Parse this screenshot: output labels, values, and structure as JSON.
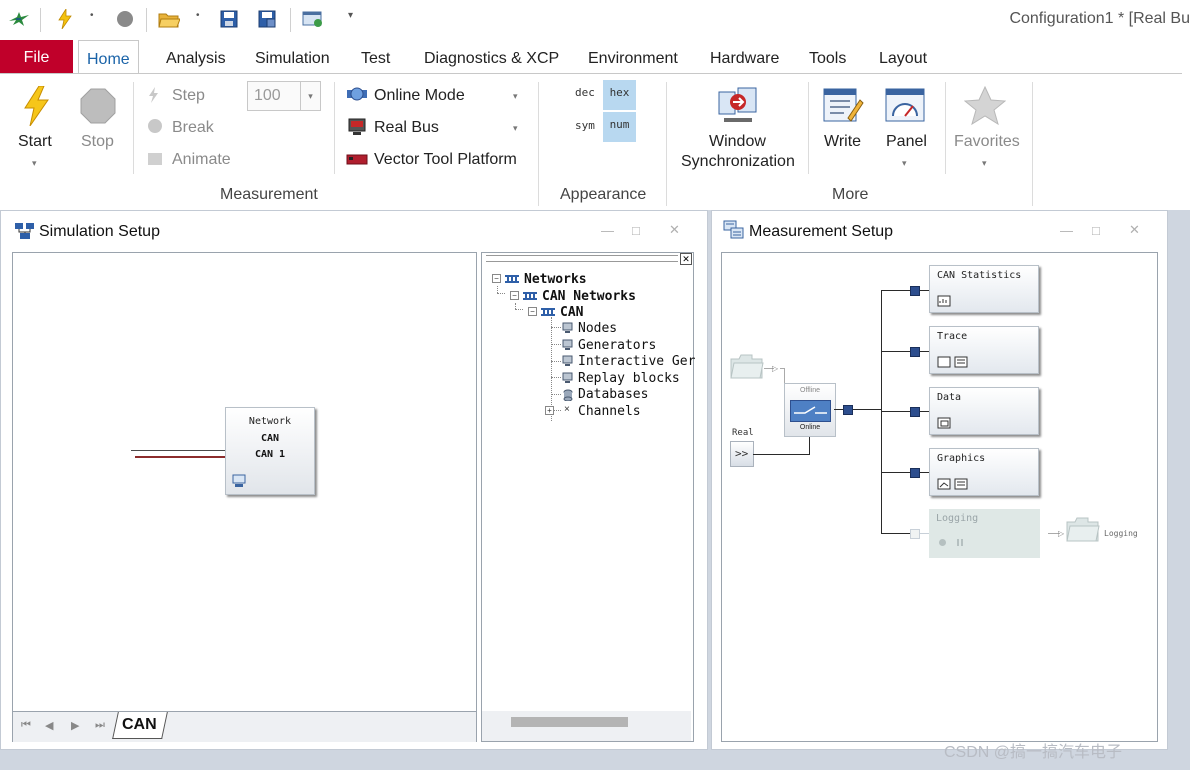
{
  "window": {
    "title": "Configuration1 * [Real Bu"
  },
  "ribbon_tabs": [
    "File",
    "Home",
    "Analysis",
    "Simulation",
    "Test",
    "Diagnostics & XCP",
    "Environment",
    "Hardware",
    "Tools",
    "Layout"
  ],
  "ribbon": {
    "start": "Start",
    "stop": "Stop",
    "step": "Step",
    "break": "Break",
    "animate": "Animate",
    "speed_value": "100",
    "online_mode": "Online Mode",
    "real_bus": "Real Bus",
    "vector_tool_platform": "Vector Tool Platform",
    "group_measurement": "Measurement",
    "dec": "dec",
    "hex": "hex",
    "sym": "sym",
    "num": "num",
    "group_appearance": "Appearance",
    "window_sync_line1": "Window",
    "window_sync_line2": "Synchronization",
    "write": "Write",
    "panel": "Panel",
    "favorites": "Favorites",
    "group_more": "More"
  },
  "simulation_setup": {
    "title": "Simulation Setup",
    "network_box": {
      "line1": "Network",
      "line2": "CAN",
      "line3": "CAN 1"
    },
    "tab_label": "CAN",
    "tree": {
      "root": "Networks",
      "can_networks": "CAN Networks",
      "can": "CAN",
      "items": [
        "Nodes",
        "Generators",
        "Interactive Ger",
        "Replay blocks",
        "Databases",
        "Channels"
      ]
    }
  },
  "measurement_setup": {
    "title": "Measurement Setup",
    "offline": "Offline",
    "online": "Online",
    "real": "Real",
    "real_button": ">>",
    "blocks": [
      "CAN Statistics",
      "Trace",
      "Data",
      "Graphics",
      "Logging"
    ],
    "logging_output": "Logging"
  },
  "watermark": "CSDN @搞一搞汽车电子",
  "colors": {
    "file_tab": "#c0002a",
    "home_tab_text": "#1a63a8",
    "connector": "#2d4e8e",
    "hex_num_highlight": "#b8d8f0"
  }
}
